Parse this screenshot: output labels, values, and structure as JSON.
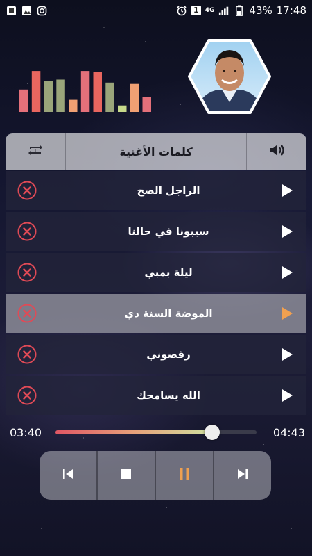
{
  "status_bar": {
    "left_icons": [
      "gallery-icon",
      "image-icon",
      "instagram-icon"
    ],
    "alarm_icon": "alarm-icon",
    "notification_count": "1",
    "network": "4G",
    "battery_percent": "43%",
    "time": "17:48"
  },
  "equalizer": {
    "levels": [
      0.52,
      0.95,
      0.72,
      0.75,
      0.28,
      0.95,
      0.92,
      0.68,
      0.15,
      0.65,
      0.35
    ],
    "colors": [
      "#e4707a",
      "#e9665f",
      "#9aa57a",
      "#9aa57a",
      "#f0a073",
      "#e4707a",
      "#e9665f",
      "#9aa57a",
      "#c7d98a",
      "#f0a073",
      "#e4707a"
    ]
  },
  "header": {
    "title": "كلمات الأغنية",
    "repeat_icon": "repeat-one-icon",
    "volume_icon": "volume-icon"
  },
  "songs": [
    {
      "title": "الراجل الصح",
      "active": false
    },
    {
      "title": "سيبونا في حالنا",
      "active": false
    },
    {
      "title": "ليلة بمبي",
      "active": false
    },
    {
      "title": "الموضة السنة دي",
      "active": true
    },
    {
      "title": "رقصوني",
      "active": false
    },
    {
      "title": "الله يسامحك",
      "active": false
    }
  ],
  "player": {
    "current_time": "03:40",
    "total_time": "04:43",
    "progress": 0.78
  },
  "controls": {
    "prev_icon": "skip-previous-icon",
    "stop_icon": "stop-icon",
    "pause_icon": "pause-icon",
    "next_icon": "skip-next-icon"
  },
  "colors": {
    "accent": "#f0a050",
    "delete": "#e04a56",
    "play": "#ffffff"
  }
}
